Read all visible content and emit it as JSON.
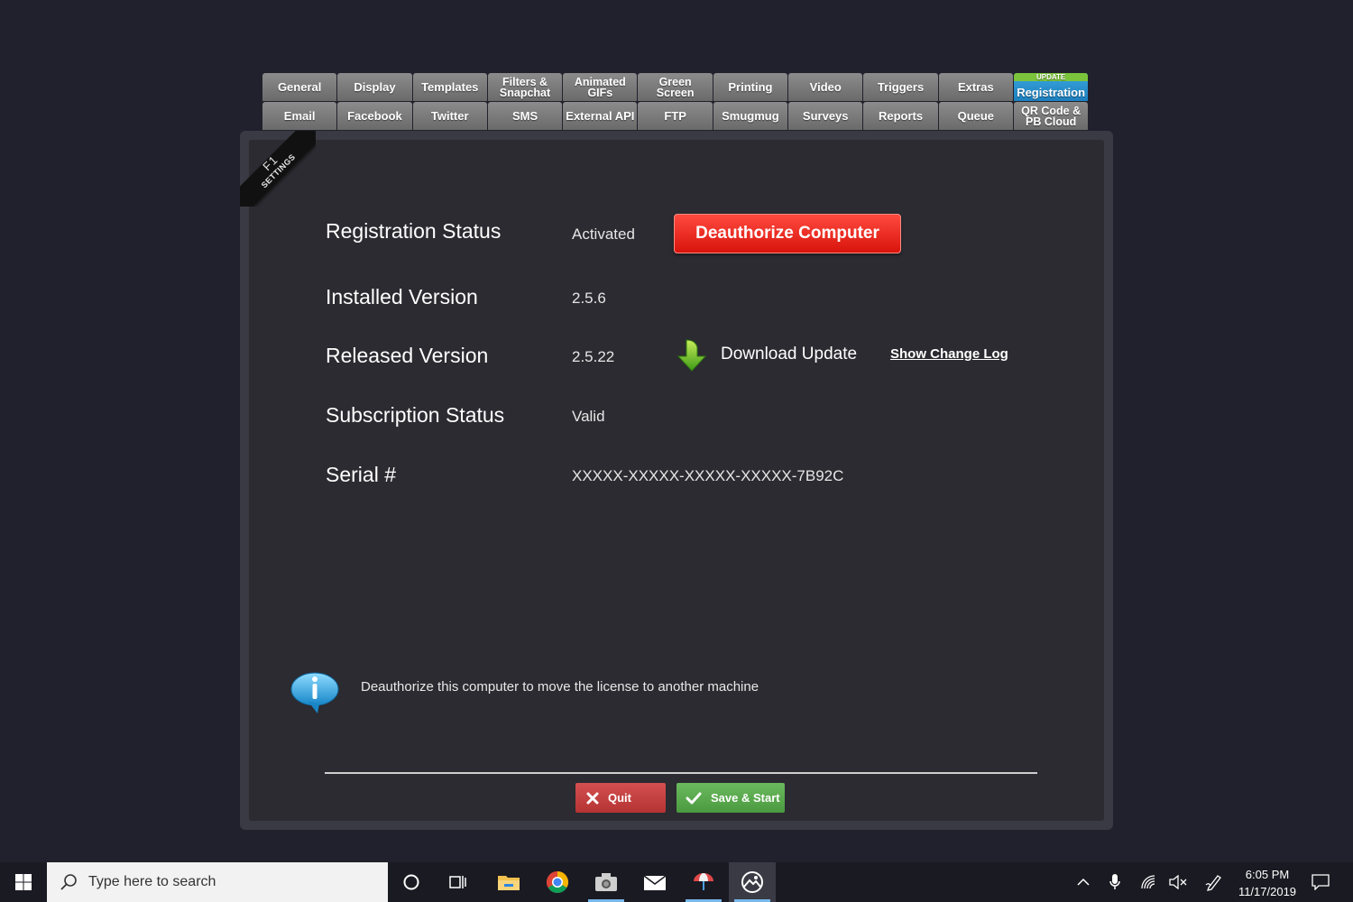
{
  "tabs": {
    "row1": [
      {
        "label": "General"
      },
      {
        "label": "Display"
      },
      {
        "label": "Templates"
      },
      {
        "label": "Filters & Snapchat"
      },
      {
        "label": "Animated GIFs"
      },
      {
        "label": "Green Screen"
      },
      {
        "label": "Printing"
      },
      {
        "label": "Video"
      },
      {
        "label": "Triggers"
      },
      {
        "label": "Extras"
      },
      {
        "label": "Registration",
        "badge": "UPDATE",
        "active": true
      }
    ],
    "row2": [
      {
        "label": "Email"
      },
      {
        "label": "Facebook"
      },
      {
        "label": "Twitter"
      },
      {
        "label": "SMS"
      },
      {
        "label": "External API"
      },
      {
        "label": "FTP"
      },
      {
        "label": "Smugmug"
      },
      {
        "label": "Surveys"
      },
      {
        "label": "Reports"
      },
      {
        "label": "Queue"
      },
      {
        "label": "QR Code & PB Cloud"
      }
    ]
  },
  "ribbon": {
    "key": "F1",
    "label": "SETTINGS"
  },
  "registration": {
    "status_label": "Registration Status",
    "status_value": "Activated",
    "deauthorize_button": "Deauthorize Computer",
    "installed_label": "Installed Version",
    "installed_value": "2.5.6",
    "released_label": "Released Version",
    "released_value": "2.5.22",
    "download_label": "Download Update",
    "changelog_link": "Show Change Log",
    "subscription_label": "Subscription Status",
    "subscription_value": "Valid",
    "serial_label": "Serial #",
    "serial_value": "XXXXX-XXXXX-XXXXX-XXXXX-7B92C"
  },
  "info": {
    "text": "Deauthorize this computer to move the license to another machine"
  },
  "footer": {
    "quit_label": "Quit",
    "save_label": "Save & Start"
  },
  "taskbar": {
    "search_placeholder": "Type here to search",
    "clock_time": "6:05 PM",
    "clock_date": "11/17/2019"
  },
  "colors": {
    "background": "#21212d",
    "panel": "#2b2b31",
    "tab": "#7b7b7b",
    "active_tab": "#2a92d0",
    "update_badge": "#7cc33c",
    "deauthorize": "#e8241a",
    "quit": "#c44040",
    "save": "#5aa94e"
  }
}
